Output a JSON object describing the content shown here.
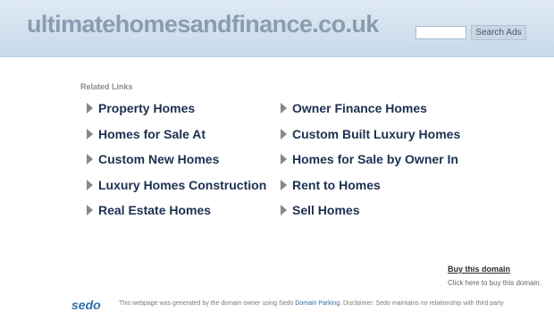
{
  "header": {
    "site_title": "ultimatehomesandfinance.co.uk",
    "search_placeholder": "",
    "search_button": "Search Ads"
  },
  "related": {
    "label": "Related Links",
    "left": [
      "Property Homes",
      "Homes for Sale At",
      "Custom New Homes",
      "Luxury Homes Construction",
      "Real Estate Homes"
    ],
    "right": [
      "Owner Finance Homes",
      "Custom Built Luxury Homes",
      "Homes for Sale by Owner In",
      "Rent to Homes",
      "Sell Homes"
    ]
  },
  "buy": {
    "link": "Buy this domain",
    "description": "Click here to buy this domain."
  },
  "footer": {
    "logo": "sedo",
    "text_before": "This webpage was generated by the domain owner using Sedo ",
    "link": "Domain Parking",
    "text_after": ". Disclaimer: Sedo maintains no relationship with third party"
  }
}
